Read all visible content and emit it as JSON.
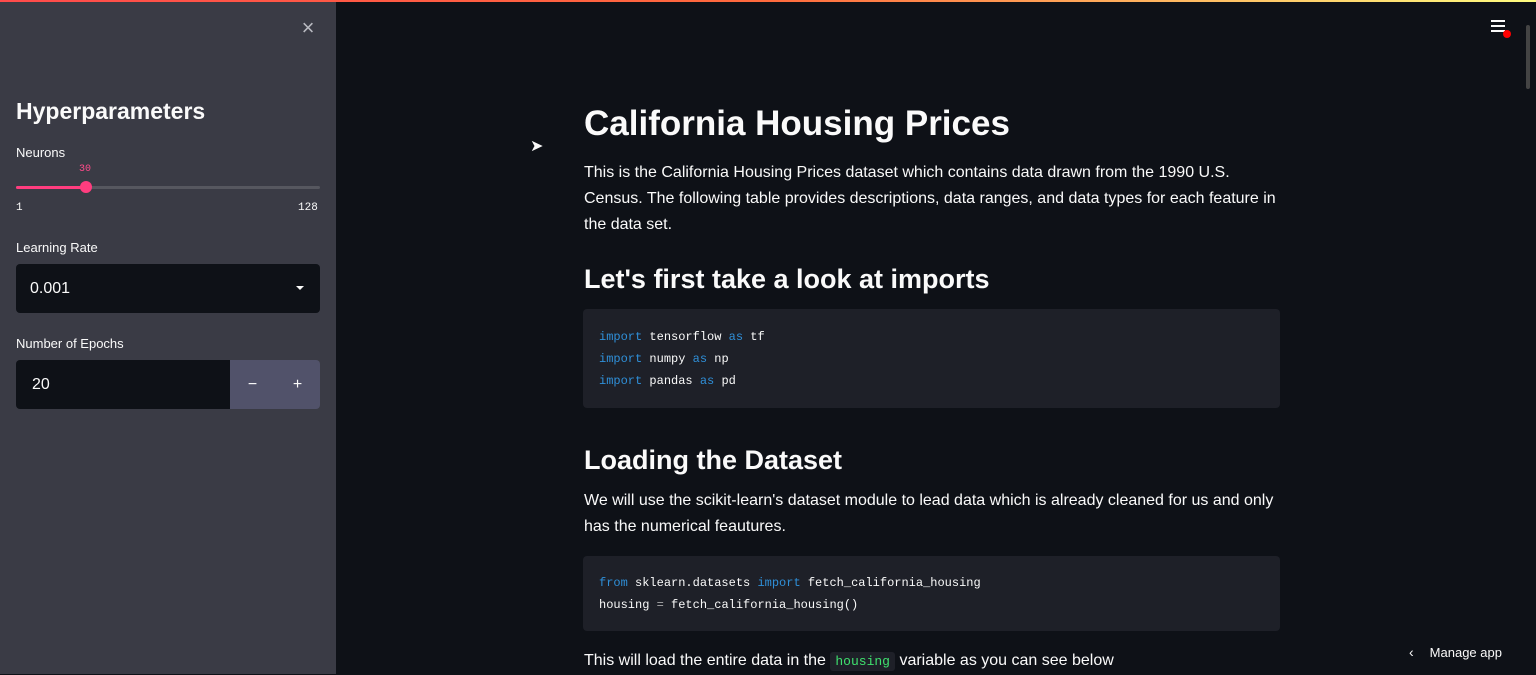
{
  "sidebar": {
    "close_icon": "close-icon",
    "title": "Hyperparameters",
    "neurons": {
      "label": "Neurons",
      "value": "30",
      "min": "1",
      "max": "128"
    },
    "learning_rate": {
      "label": "Learning Rate",
      "value": "0.001"
    },
    "epochs": {
      "label": "Number of Epochs",
      "value": "20",
      "minus": "−",
      "plus": "+"
    }
  },
  "main": {
    "title": "California Housing Prices",
    "intro": "This is the California Housing Prices dataset which contains data drawn from the 1990 U.S. Census. The following table provides descriptions, data ranges, and data types for each feature in the data set.",
    "imports_heading": "Let's first take a look at imports",
    "imports_code": [
      {
        "kw": "import",
        "mod": "tensorflow",
        "as": "as",
        "alias": "tf"
      },
      {
        "kw": "import",
        "mod": "numpy",
        "as": "as",
        "alias": "np"
      },
      {
        "kw": "import",
        "mod": "pandas",
        "as": "as",
        "alias": "pd"
      }
    ],
    "loading_heading": "Loading the Dataset",
    "loading_text": "We will use the scikit-learn's dataset module to lead data which is already cleaned for us and only has the numerical feautures.",
    "load_code": {
      "line1": {
        "from": "from",
        "module": "sklearn.datasets",
        "import": "import",
        "name": "fetch_california_housing"
      },
      "line2": {
        "var": "housing",
        "eq": "=",
        "call": "fetch_california_housing()"
      }
    },
    "last_text_before": "This will load the entire data in the",
    "last_text_code": "housing",
    "last_text_after": "variable as you can see below"
  },
  "header": {
    "menu_icon": "hamburger-menu-icon"
  },
  "footer": {
    "manage_label": "Manage app"
  },
  "colors": {
    "accent": "#ff3d7f",
    "keyword": "#2f8fd8",
    "inline_code": "#3fe06e"
  }
}
